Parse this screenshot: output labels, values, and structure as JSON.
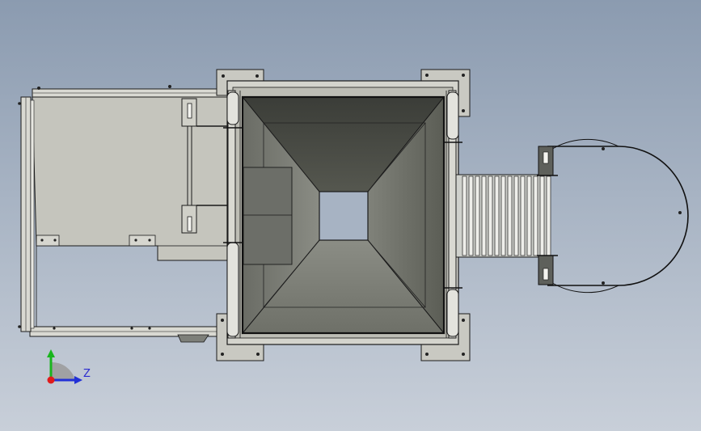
{
  "triad": {
    "z_label": "Z"
  },
  "colors": {
    "background_top": "#8b9bb0",
    "background_bottom": "#c8cfd9",
    "panel": "#c5c5bd",
    "edge": "#1a1a1a",
    "x_axis": "#e01b1b",
    "y_axis": "#19b51d",
    "z_axis": "#2231d6"
  }
}
